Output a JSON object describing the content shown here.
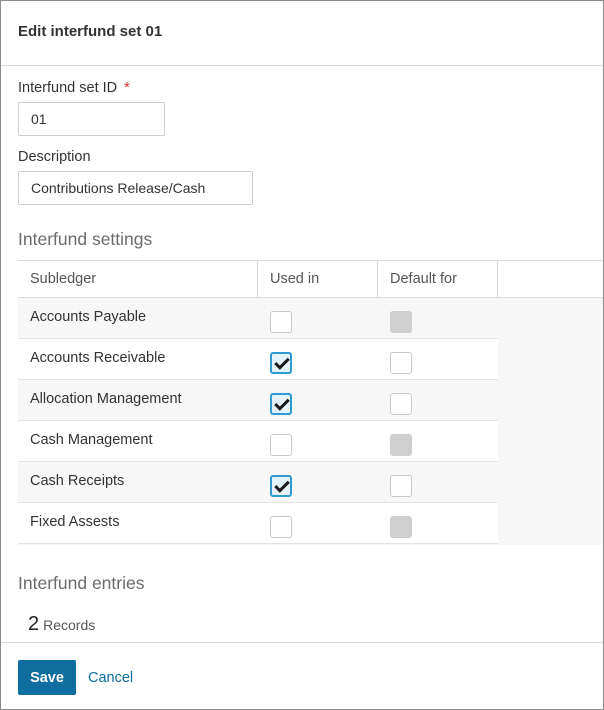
{
  "header": {
    "title": "Edit interfund set 01"
  },
  "form": {
    "id_label": "Interfund set ID",
    "id_required_mark": "*",
    "id_value": "01",
    "description_label": "Description",
    "description_value": "Contributions Release/Cash"
  },
  "settings": {
    "title": "Interfund settings",
    "columns": [
      "Subledger",
      "Used in",
      "Default for"
    ],
    "rows": [
      {
        "subledger": "Accounts Payable",
        "used_in": false,
        "default_for": "disabled"
      },
      {
        "subledger": "Accounts Receivable",
        "used_in": true,
        "default_for": "unchecked"
      },
      {
        "subledger": "Allocation Management",
        "used_in": true,
        "default_for": "unchecked"
      },
      {
        "subledger": "Cash Management",
        "used_in": false,
        "default_for": "disabled"
      },
      {
        "subledger": "Cash Receipts",
        "used_in": true,
        "default_for": "unchecked"
      },
      {
        "subledger": "Fixed Assests",
        "used_in": false,
        "default_for": "disabled"
      }
    ]
  },
  "entries": {
    "title": "Interfund entries",
    "record_count": "2",
    "record_label": "Records"
  },
  "footer": {
    "save_label": "Save",
    "cancel_label": "Cancel"
  },
  "colors": {
    "primary": "#0f6e9f",
    "check_border": "#2f9bd3",
    "required": "#d0312d"
  }
}
